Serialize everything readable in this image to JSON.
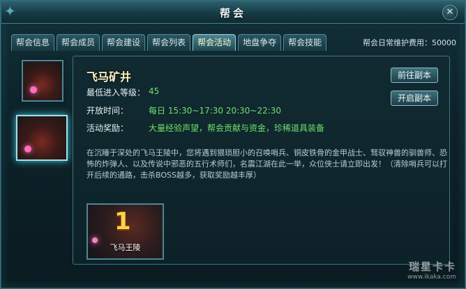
{
  "window": {
    "title": "帮会"
  },
  "tabs": [
    {
      "label": "帮会信息",
      "active": false
    },
    {
      "label": "帮会成员",
      "active": false
    },
    {
      "label": "帮会建设",
      "active": false
    },
    {
      "label": "帮会列表",
      "active": false
    },
    {
      "label": "帮会活动",
      "active": true
    },
    {
      "label": "地盘争夺",
      "active": false
    },
    {
      "label": "帮会技能",
      "active": false
    }
  ],
  "fee": "帮会日常维护费用：50000",
  "dungeon": {
    "name": "飞马矿井",
    "min_level_label": "最低进入等级：",
    "min_level": "45",
    "open_time_label": "开放时间：",
    "open_time": "每日 15:30~17:30 20:30~22:30",
    "reward_label": "活动奖励：",
    "reward": "大量经验声望，帮会贡献与资金，珍稀道具装备",
    "description": "在沉睡于深处的飞马王陵中，您将遇到猥琐胆小的召唤哨兵、铜皮铁骨的金甲战士、驽驭神兽的驯兽师、恐怖的炸弹人、以及传说中邪恶的五行术师们，名震江湖在此一举，众位侠士请立即出发！（清除哨兵可以打开后续的通路，击杀BOSS越多，获取奖励越丰厚）"
  },
  "buttons": {
    "go": "前往副本",
    "open": "开启副本"
  },
  "card": {
    "number": "1",
    "caption": "飞马王陵"
  },
  "watermark": {
    "line1": "瑞星卡卡",
    "line2": "www.ikaka.com"
  },
  "colors": {
    "accent_green": "#6fe06a",
    "gold": "#ffd24a",
    "frame": "#2f6a78"
  }
}
